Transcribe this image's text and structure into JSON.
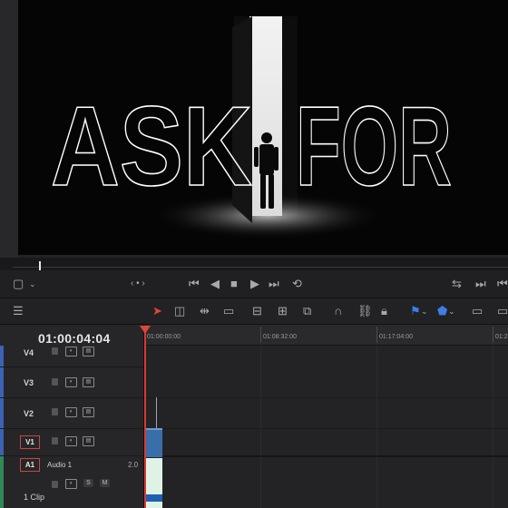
{
  "viewer": {
    "title_words": [
      "ASK",
      "FOR"
    ],
    "nav_label": "‹ • ›"
  },
  "timeline": {
    "timecode": "01:00:04:04",
    "ruler_labels": [
      "01:00:00:00",
      "01:08:32:00",
      "01:17:04:00",
      "01:2"
    ]
  },
  "tracks": {
    "v4": {
      "name": "V4"
    },
    "v3": {
      "name": "V3"
    },
    "v2": {
      "name": "V2"
    },
    "v1": {
      "name": "V1"
    },
    "a1": {
      "name": "A1",
      "label": "Audio 1",
      "level": "2.0",
      "clip_count": "1 Clip",
      "solo": "S",
      "mute": "M"
    }
  },
  "colors": {
    "playhead": "#e0453a",
    "flag": "#3d7ee8",
    "video_clip": "#3a6ea8",
    "audio_clip": "#dff2e6"
  }
}
